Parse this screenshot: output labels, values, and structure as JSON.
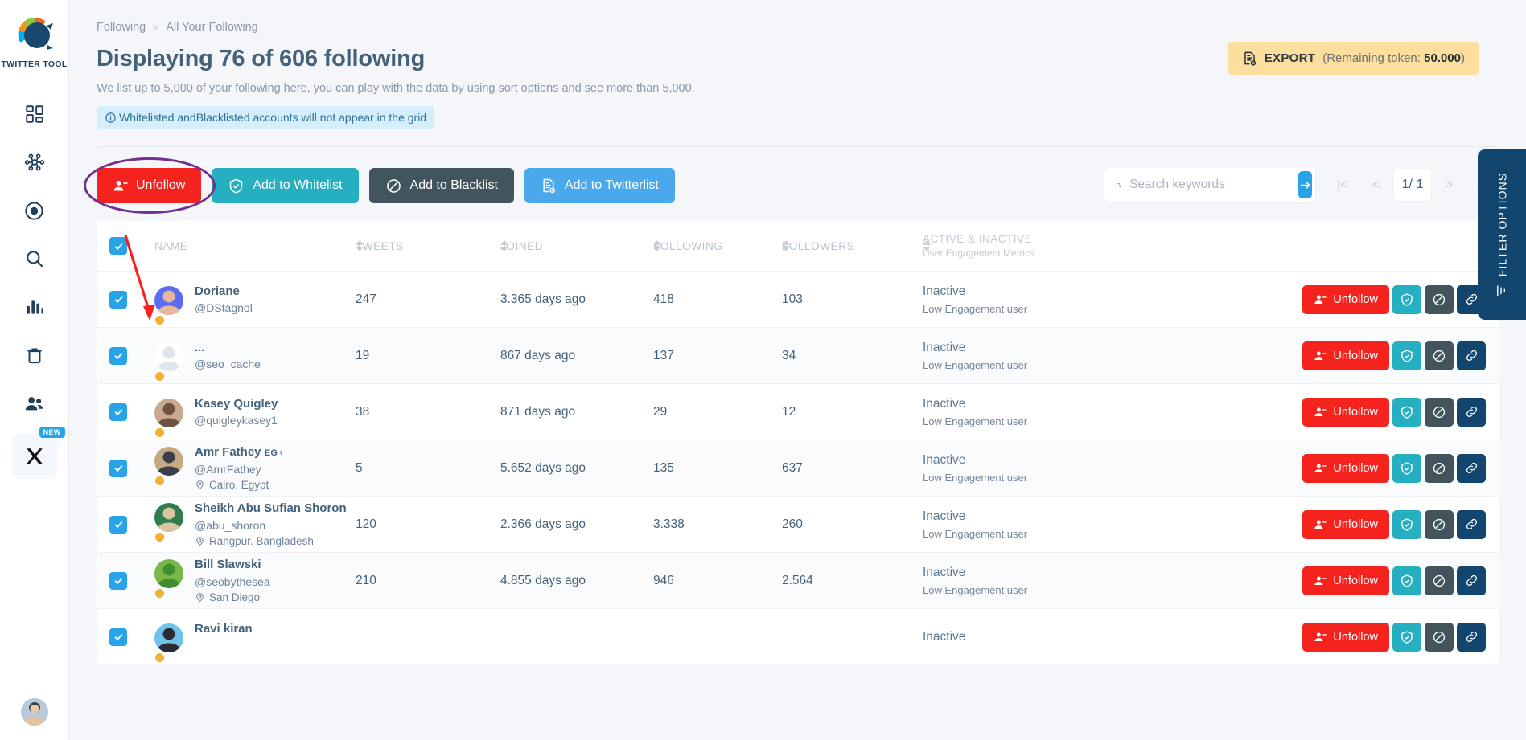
{
  "sidebar": {
    "logo_label": "TWITTER TOOL",
    "items": [
      {
        "name": "dashboard",
        "icon": "dashboard-icon"
      },
      {
        "name": "network",
        "icon": "network-icon"
      },
      {
        "name": "target",
        "icon": "target-icon"
      },
      {
        "name": "search",
        "icon": "search-icon"
      },
      {
        "name": "analytics",
        "icon": "bar-chart-icon"
      },
      {
        "name": "trash",
        "icon": "trash-icon"
      },
      {
        "name": "users",
        "icon": "users-icon"
      }
    ],
    "x_badge": "NEW"
  },
  "breadcrumb": {
    "parent": "Following",
    "separator": ">",
    "current": "All Your Following"
  },
  "header": {
    "title": "Displaying 76 of 606 following",
    "subtitle": "We list up to 5,000 of your following here, you can play with the data by using sort options and see more than 5,000.",
    "info_banner": "Whitelisted andBlacklisted accounts will not appear in the grid"
  },
  "export": {
    "label": "EXPORT",
    "token_text": "(Remaining token: ",
    "token_value": "50.000",
    "token_close": ")"
  },
  "actions": {
    "unfollow": "Unfollow",
    "whitelist": "Add to Whitelist",
    "blacklist": "Add to Blacklist",
    "twitterlist": "Add to Twitterlist"
  },
  "search": {
    "placeholder": "Search keywords",
    "value": ""
  },
  "pagination": {
    "first": "|<",
    "prev": "<",
    "current": "1/ 1",
    "next": ">",
    "last": ">|"
  },
  "table": {
    "columns": {
      "name": "NAME",
      "tweets": "TWEETS",
      "joined": "JOINED",
      "following": "FOLLOWING",
      "followers": "FOLLOWERS",
      "active_main": "ACTIVE & INACTIVE",
      "active_sub": "User Engagement Metrics"
    },
    "rows": [
      {
        "checked": true,
        "name": "Doriane",
        "name_suffix": "",
        "handle": "@DStagnol",
        "location": "",
        "tweets": "247",
        "joined": "3.365 days ago",
        "following": "418",
        "followers": "103",
        "status": "Inactive",
        "engagement": "Low Engagement user",
        "avatar_colors": [
          "#5b6cf0",
          "#e8b79a"
        ]
      },
      {
        "checked": true,
        "name": "...",
        "name_suffix": "",
        "handle": "@seo_cache",
        "location": "",
        "tweets": "19",
        "joined": "867 days ago",
        "following": "137",
        "followers": "34",
        "status": "Inactive",
        "engagement": "Low Engagement user",
        "avatar_colors": [
          "#ffffff",
          "#dfe5ec"
        ]
      },
      {
        "checked": true,
        "name": "Kasey Quigley",
        "name_suffix": "",
        "handle": "@quigleykasey1",
        "location": "",
        "tweets": "38",
        "joined": "871 days ago",
        "following": "29",
        "followers": "12",
        "status": "Inactive",
        "engagement": "Low Engagement user",
        "avatar_colors": [
          "#c9a98f",
          "#6e5340"
        ]
      },
      {
        "checked": true,
        "name": "Amr Fathey",
        "name_suffix": "EG♀",
        "handle": "@AmrFathey",
        "location": "Cairo, Egypt",
        "tweets": "5",
        "joined": "5.652 days ago",
        "following": "135",
        "followers": "637",
        "status": "Inactive",
        "engagement": "Low Engagement user",
        "avatar_colors": [
          "#c6a882",
          "#3b3e49"
        ]
      },
      {
        "checked": true,
        "name": "Sheikh Abu Sufian Shoron",
        "name_suffix": "",
        "handle": "@abu_shoron",
        "location": "Rangpur. Bangladesh",
        "tweets": "120",
        "joined": "2.366 days ago",
        "following": "3.338",
        "followers": "260",
        "status": "Inactive",
        "engagement": "Low Engagement user",
        "avatar_colors": [
          "#2f7d4f",
          "#d9c5a0"
        ]
      },
      {
        "checked": true,
        "name": "Bill Slawski",
        "name_suffix": "",
        "handle": "@seobythesea",
        "location": "San Diego",
        "tweets": "210",
        "joined": "4.855 days ago",
        "following": "946",
        "followers": "2.564",
        "status": "Inactive",
        "engagement": "Low Engagement user",
        "avatar_colors": [
          "#7ab648",
          "#3f8f2e"
        ]
      },
      {
        "checked": true,
        "name": "Ravi kiran",
        "name_suffix": "",
        "handle": "",
        "location": "",
        "tweets": "",
        "joined": "",
        "following": "",
        "followers": "",
        "status": "Inactive",
        "engagement": "",
        "avatar_colors": [
          "#6fc3e8",
          "#2b2b33"
        ]
      }
    ],
    "row_actions": {
      "unfollow": "Unfollow",
      "whitelist_icon": "shield-check-icon",
      "blacklist_icon": "ban-icon",
      "link_icon": "link-icon"
    }
  },
  "filter_tab": {
    "label": "FILTER OPTIONS"
  },
  "colors": {
    "accent_blue": "#29a3e8",
    "danger_red": "#f5231e",
    "teal": "#26afc0",
    "slate": "#42555c",
    "navy": "#12466f",
    "export_yellow": "#fcdf9c",
    "annotation_purple": "#73308f"
  }
}
